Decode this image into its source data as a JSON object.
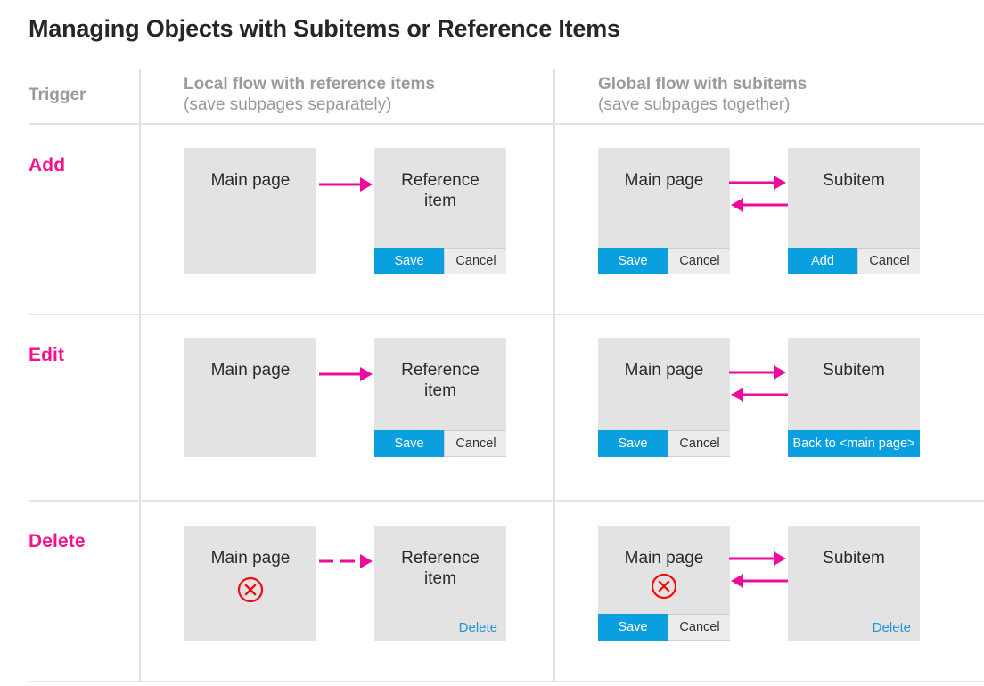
{
  "page": {
    "title": "Managing Objects with Subitems or Reference Items"
  },
  "columns": {
    "trigger_label": "Trigger",
    "local": {
      "heading": "Local flow with reference items",
      "subheading": "(save subpages separately)"
    },
    "global": {
      "heading": "Global flow with subitems",
      "subheading": "(save subpages together)"
    }
  },
  "colors": {
    "trigger_accent": "#f5108c",
    "card_bg": "#e3e3e3",
    "primary_button": "#0aa0e0",
    "secondary_button": "#ececec",
    "arrow": "#ee0a9a",
    "delete_icon": "#f20d0d",
    "link": "#2196dd",
    "header_text": "#9a9a9a",
    "rule": "#e4e4e4"
  },
  "rows": [
    {
      "label": "Add",
      "local": {
        "source_card": {
          "title": "Main page",
          "buttons": []
        },
        "arrow": {
          "type": "single",
          "style": "solid"
        },
        "target_card": {
          "title_line1": "Reference",
          "title_line2": "item",
          "buttons": [
            {
              "label": "Save",
              "variant": "primary"
            },
            {
              "label": "Cancel",
              "variant": "secondary"
            }
          ]
        }
      },
      "global": {
        "source_card": {
          "title": "Main page",
          "buttons": [
            {
              "label": "Save",
              "variant": "primary"
            },
            {
              "label": "Cancel",
              "variant": "secondary"
            }
          ]
        },
        "arrow": {
          "type": "double",
          "style": "solid"
        },
        "target_card": {
          "title_line1": "Subitem",
          "title_line2": "",
          "buttons": [
            {
              "label": "Add",
              "variant": "primary"
            },
            {
              "label": "Cancel",
              "variant": "secondary"
            }
          ]
        }
      }
    },
    {
      "label": "Edit",
      "local": {
        "source_card": {
          "title": "Main page",
          "buttons": []
        },
        "arrow": {
          "type": "single",
          "style": "solid"
        },
        "target_card": {
          "title_line1": "Reference",
          "title_line2": "item",
          "buttons": [
            {
              "label": "Save",
              "variant": "primary"
            },
            {
              "label": "Cancel",
              "variant": "secondary"
            }
          ]
        }
      },
      "global": {
        "source_card": {
          "title": "Main page",
          "buttons": [
            {
              "label": "Save",
              "variant": "primary"
            },
            {
              "label": "Cancel",
              "variant": "secondary"
            }
          ]
        },
        "arrow": {
          "type": "double",
          "style": "solid"
        },
        "target_card": {
          "title_line1": "Subitem",
          "title_line2": "",
          "buttons": [
            {
              "label": "Back to <main page>",
              "variant": "primary"
            }
          ]
        }
      }
    },
    {
      "label": "Delete",
      "local": {
        "source_card": {
          "title": "Main page",
          "icon": "delete-circle-x-icon",
          "buttons": []
        },
        "arrow": {
          "type": "single",
          "style": "dashed"
        },
        "target_card": {
          "title_line1": "Reference",
          "title_line2": "item",
          "link": "Delete",
          "buttons": []
        }
      },
      "global": {
        "source_card": {
          "title": "Main page",
          "icon": "delete-circle-x-icon",
          "buttons": [
            {
              "label": "Save",
              "variant": "primary"
            },
            {
              "label": "Cancel",
              "variant": "secondary"
            }
          ]
        },
        "arrow": {
          "type": "double",
          "style": "solid"
        },
        "target_card": {
          "title_line1": "Subitem",
          "title_line2": "",
          "link": "Delete",
          "buttons": []
        }
      }
    }
  ]
}
